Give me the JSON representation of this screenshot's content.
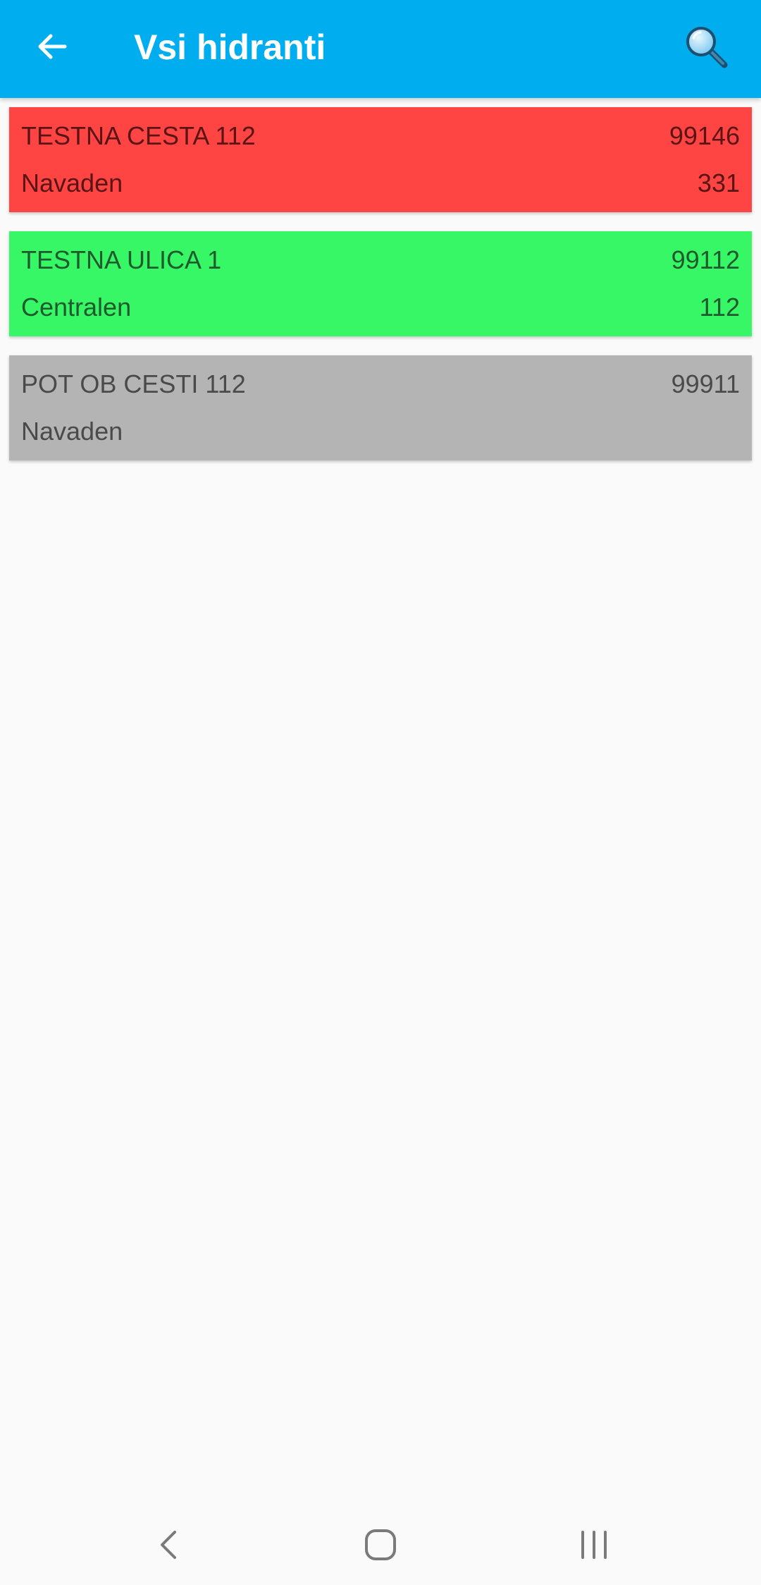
{
  "app_bar": {
    "title": "Vsi hidranti",
    "background": "#00aeef",
    "back_icon": "arrow-left-icon",
    "search_icon": "magnifier-icon"
  },
  "hydrants": [
    {
      "address": "TESTNA CESTA 112",
      "number": "99146",
      "type": "Navaden",
      "code": "331",
      "color": "#ff4444",
      "text_color": "#5a1414"
    },
    {
      "address": "TESTNA ULICA 1",
      "number": "99112",
      "type": "Centralen",
      "code": "112",
      "color": "#38f766",
      "text_color": "#1e5a2c"
    },
    {
      "address": "POT OB CESTI 112",
      "number": "99911",
      "type": "Navaden",
      "code": "",
      "color": "#b4b4b4",
      "text_color": "#4a4a4a"
    }
  ],
  "nav_bar": {
    "back_icon": "chevron-left-icon",
    "home_icon": "home-square-icon",
    "recents_icon": "recents-bars-icon"
  }
}
